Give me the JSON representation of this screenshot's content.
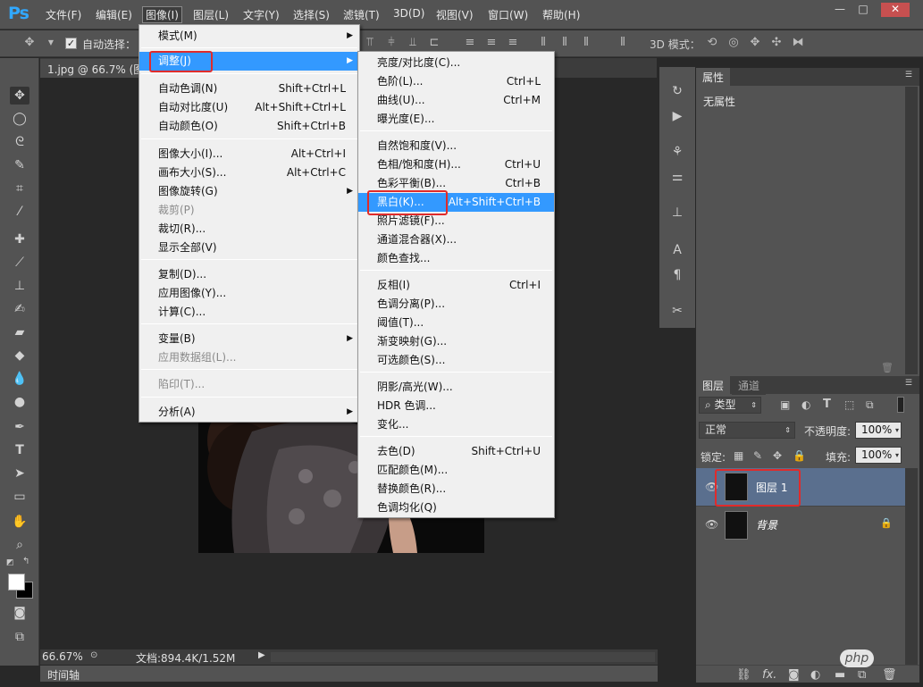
{
  "app": {
    "logo": "Ps"
  },
  "menubar": [
    {
      "label": "文件(F)"
    },
    {
      "label": "编辑(E)"
    },
    {
      "label": "图像(I)"
    },
    {
      "label": "图层(L)"
    },
    {
      "label": "文字(Y)"
    },
    {
      "label": "选择(S)"
    },
    {
      "label": "滤镜(T)"
    },
    {
      "label": "3D(D)"
    },
    {
      "label": "视图(V)"
    },
    {
      "label": "窗口(W)"
    },
    {
      "label": "帮助(H)"
    }
  ],
  "window_controls": {
    "minimize": "—",
    "maximize": "□",
    "close": "✕"
  },
  "options_bar": {
    "auto_select_label": "自动选择：",
    "mode_3d_label": "3D 模式："
  },
  "document": {
    "tab_title": "1.jpg @ 66.7% (图"
  },
  "image_menu": {
    "items": [
      {
        "label": "模式(M)",
        "shortcut": "",
        "submenu": true,
        "disabled": false
      },
      {
        "label": "调整(J)",
        "shortcut": "",
        "submenu": true,
        "disabled": false
      },
      {
        "label": "自动色调(N)",
        "shortcut": "Shift+Ctrl+L",
        "submenu": false,
        "disabled": false
      },
      {
        "label": "自动对比度(U)",
        "shortcut": "Alt+Shift+Ctrl+L",
        "submenu": false,
        "disabled": false
      },
      {
        "label": "自动颜色(O)",
        "shortcut": "Shift+Ctrl+B",
        "submenu": false,
        "disabled": false
      },
      {
        "label": "图像大小(I)...",
        "shortcut": "Alt+Ctrl+I",
        "submenu": false,
        "disabled": false
      },
      {
        "label": "画布大小(S)...",
        "shortcut": "Alt+Ctrl+C",
        "submenu": false,
        "disabled": false
      },
      {
        "label": "图像旋转(G)",
        "shortcut": "",
        "submenu": true,
        "disabled": false
      },
      {
        "label": "裁剪(P)",
        "shortcut": "",
        "submenu": false,
        "disabled": true
      },
      {
        "label": "裁切(R)...",
        "shortcut": "",
        "submenu": false,
        "disabled": false
      },
      {
        "label": "显示全部(V)",
        "shortcut": "",
        "submenu": false,
        "disabled": false
      },
      {
        "label": "复制(D)...",
        "shortcut": "",
        "submenu": false,
        "disabled": false
      },
      {
        "label": "应用图像(Y)...",
        "shortcut": "",
        "submenu": false,
        "disabled": false
      },
      {
        "label": "计算(C)...",
        "shortcut": "",
        "submenu": false,
        "disabled": false
      },
      {
        "label": "变量(B)",
        "shortcut": "",
        "submenu": true,
        "disabled": false
      },
      {
        "label": "应用数据组(L)...",
        "shortcut": "",
        "submenu": false,
        "disabled": true
      },
      {
        "label": "陷印(T)...",
        "shortcut": "",
        "submenu": false,
        "disabled": true
      },
      {
        "label": "分析(A)",
        "shortcut": "",
        "submenu": true,
        "disabled": false
      }
    ]
  },
  "adjust_menu": {
    "items": [
      {
        "label": "亮度/对比度(C)...",
        "shortcut": ""
      },
      {
        "label": "色阶(L)...",
        "shortcut": "Ctrl+L"
      },
      {
        "label": "曲线(U)...",
        "shortcut": "Ctrl+M"
      },
      {
        "label": "曝光度(E)...",
        "shortcut": ""
      },
      {
        "label": "自然饱和度(V)...",
        "shortcut": ""
      },
      {
        "label": "色相/饱和度(H)...",
        "shortcut": "Ctrl+U"
      },
      {
        "label": "色彩平衡(B)...",
        "shortcut": "Ctrl+B"
      },
      {
        "label": "黑白(K)...",
        "shortcut": "Alt+Shift+Ctrl+B"
      },
      {
        "label": "照片滤镜(F)...",
        "shortcut": ""
      },
      {
        "label": "通道混合器(X)...",
        "shortcut": ""
      },
      {
        "label": "颜色查找...",
        "shortcut": ""
      },
      {
        "label": "反相(I)",
        "shortcut": "Ctrl+I"
      },
      {
        "label": "色调分离(P)...",
        "shortcut": ""
      },
      {
        "label": "阈值(T)...",
        "shortcut": ""
      },
      {
        "label": "渐变映射(G)...",
        "shortcut": ""
      },
      {
        "label": "可选颜色(S)...",
        "shortcut": ""
      },
      {
        "label": "阴影/高光(W)...",
        "shortcut": ""
      },
      {
        "label": "HDR 色调...",
        "shortcut": ""
      },
      {
        "label": "变化...",
        "shortcut": ""
      },
      {
        "label": "去色(D)",
        "shortcut": "Shift+Ctrl+U"
      },
      {
        "label": "匹配颜色(M)...",
        "shortcut": ""
      },
      {
        "label": "替换颜色(R)...",
        "shortcut": ""
      },
      {
        "label": "色调均化(Q)",
        "shortcut": ""
      }
    ]
  },
  "properties_panel": {
    "tab": "属性",
    "empty_text": "无属性"
  },
  "layers_panel": {
    "tabs": [
      "图层",
      "通道"
    ],
    "filter_kind": "类型",
    "blend_mode": "正常",
    "opacity_label": "不透明度:",
    "opacity_value": "100%",
    "lock_label": "锁定:",
    "fill_label": "填充:",
    "fill_value": "100%",
    "layers": [
      {
        "name": "图层 1",
        "selected": true
      },
      {
        "name": "背景",
        "selected": false,
        "locked": true
      }
    ]
  },
  "status": {
    "zoom": "66.67%",
    "doc_info": "文档:894.4K/1.52M"
  },
  "timeline": {
    "label": "时间轴"
  },
  "watermark": "php",
  "colors": {
    "highlight": "#3399ff",
    "annotation": "#e02b2b",
    "layer_selected": "#5a6f8e"
  }
}
